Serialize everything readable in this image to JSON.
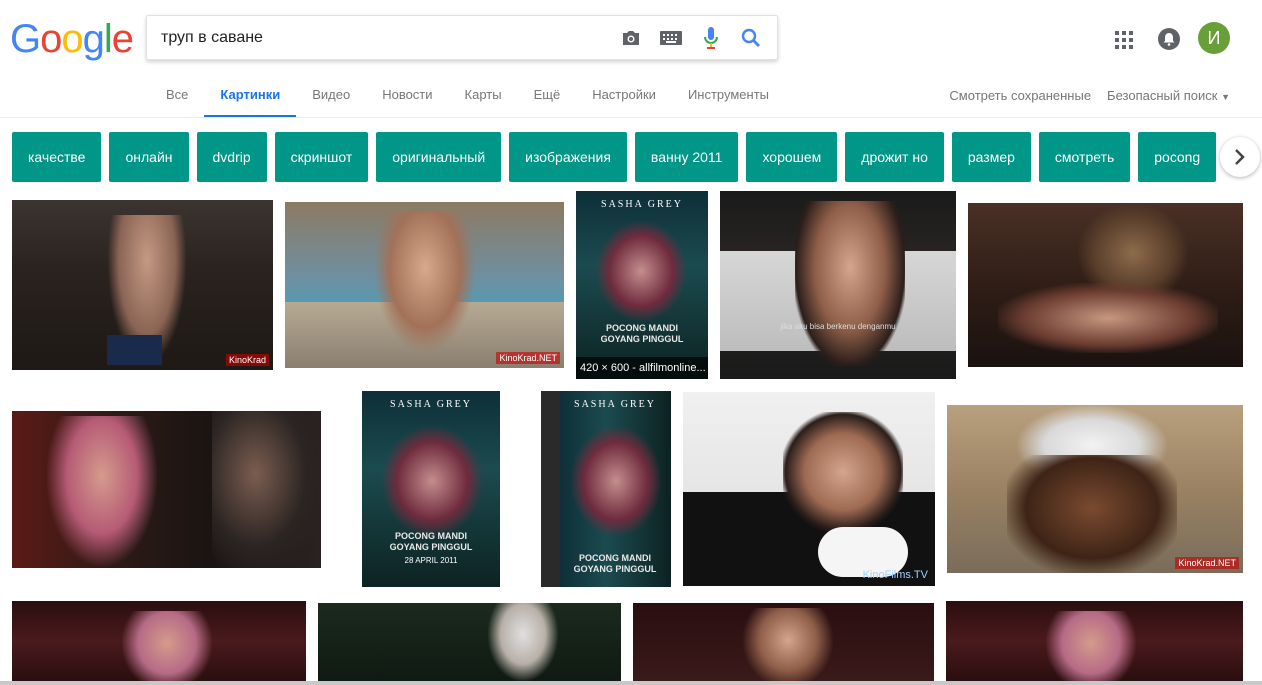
{
  "logo": {
    "letters": [
      "G",
      "o",
      "o",
      "g",
      "l",
      "e"
    ],
    "colors": [
      "#4285F4",
      "#EA4335",
      "#FBBC05",
      "#4285F4",
      "#34A853",
      "#EA4335"
    ]
  },
  "search": {
    "query": "труп в саване"
  },
  "avatar": {
    "initial": "И",
    "color": "#689f38"
  },
  "tabs": [
    {
      "label": "Все",
      "active": false
    },
    {
      "label": "Картинки",
      "active": true
    },
    {
      "label": "Видео",
      "active": false
    },
    {
      "label": "Новости",
      "active": false
    },
    {
      "label": "Карты",
      "active": false
    },
    {
      "label": "Ещё",
      "active": false
    },
    {
      "label": "Настройки",
      "active": false
    },
    {
      "label": "Инструменты",
      "active": false
    }
  ],
  "tabs_right": {
    "saved": "Смотреть сохраненные",
    "safe_search": "Безопасный поиск"
  },
  "chips": [
    "качестве",
    "онлайн",
    "dvdrip",
    "скриншот",
    "оригинальный",
    "изображения",
    "ванну 2011",
    "хорошем",
    "дрожит но",
    "размер",
    "смотреть",
    "pocong"
  ],
  "images": [
    {
      "name": "result-1",
      "watermark": "KinoKrad"
    },
    {
      "name": "result-2",
      "watermark": "KinoKrad.NET"
    },
    {
      "name": "result-3",
      "poster_title": "SASHA GREY",
      "poster_sub": "POCONG MANDI\nGOYANG PINGGUL",
      "poster_date": "28 APRIL 2011",
      "caption": "420 × 600 - allfilmonline..."
    },
    {
      "name": "result-4",
      "subtitle": "jika aku bisa berkenu denganmu"
    },
    {
      "name": "result-5"
    },
    {
      "name": "result-6"
    },
    {
      "name": "result-7",
      "poster_title": "SASHA GREY",
      "poster_sub": "POCONG MANDI\nGOYANG PINGGUL",
      "poster_date": "28 APRIL 2011"
    },
    {
      "name": "result-8",
      "poster_title": "SASHA GREY",
      "poster_sub": "POCONG MANDI\nGOYANG PINGGUL"
    },
    {
      "name": "result-9",
      "watermark": "KinoFilms.TV"
    },
    {
      "name": "result-10",
      "watermark": "KinoKrad.NET"
    },
    {
      "name": "result-11"
    },
    {
      "name": "result-12"
    },
    {
      "name": "result-13"
    },
    {
      "name": "result-14"
    }
  ]
}
